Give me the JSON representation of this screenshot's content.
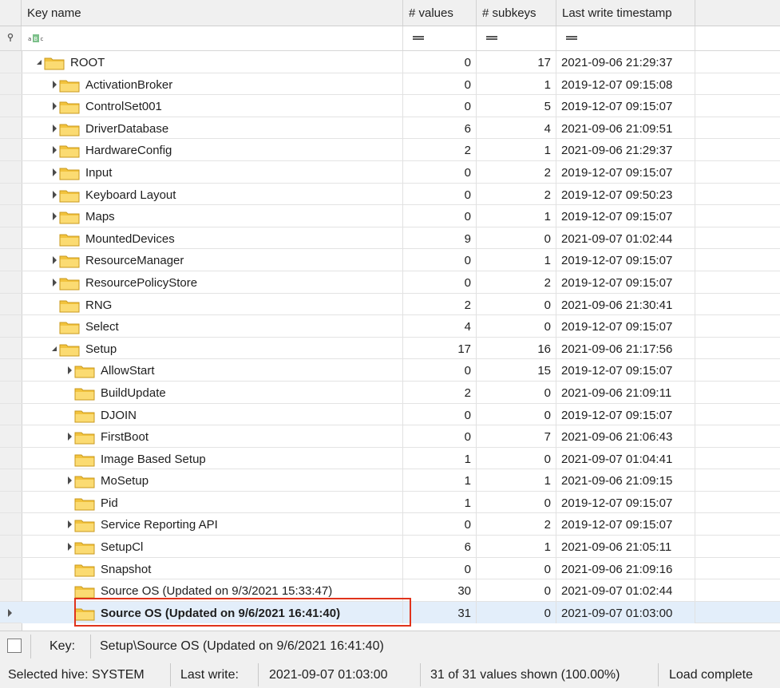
{
  "columns": {
    "key_name": "Key name",
    "values": "# values",
    "subkeys": "# subkeys",
    "timestamp": "Last write timestamp"
  },
  "filter": {
    "key_name_icon": "text-filter-icon",
    "operator_symbol": "="
  },
  "rows": [
    {
      "name": "ROOT",
      "values": "0",
      "subkeys": "17",
      "timestamp": "2021-09-06 21:29:37",
      "level": 0,
      "state": "expanded"
    },
    {
      "name": "ActivationBroker",
      "values": "0",
      "subkeys": "1",
      "timestamp": "2019-12-07 09:15:08",
      "level": 1,
      "state": "collapsed"
    },
    {
      "name": "ControlSet001",
      "values": "0",
      "subkeys": "5",
      "timestamp": "2019-12-07 09:15:07",
      "level": 1,
      "state": "collapsed"
    },
    {
      "name": "DriverDatabase",
      "values": "6",
      "subkeys": "4",
      "timestamp": "2021-09-06 21:09:51",
      "level": 1,
      "state": "collapsed"
    },
    {
      "name": "HardwareConfig",
      "values": "2",
      "subkeys": "1",
      "timestamp": "2021-09-06 21:29:37",
      "level": 1,
      "state": "collapsed"
    },
    {
      "name": "Input",
      "values": "0",
      "subkeys": "2",
      "timestamp": "2019-12-07 09:15:07",
      "level": 1,
      "state": "collapsed"
    },
    {
      "name": "Keyboard Layout",
      "values": "0",
      "subkeys": "2",
      "timestamp": "2019-12-07 09:50:23",
      "level": 1,
      "state": "collapsed"
    },
    {
      "name": "Maps",
      "values": "0",
      "subkeys": "1",
      "timestamp": "2019-12-07 09:15:07",
      "level": 1,
      "state": "collapsed"
    },
    {
      "name": "MountedDevices",
      "values": "9",
      "subkeys": "0",
      "timestamp": "2021-09-07 01:02:44",
      "level": 1,
      "state": "leaf"
    },
    {
      "name": "ResourceManager",
      "values": "0",
      "subkeys": "1",
      "timestamp": "2019-12-07 09:15:07",
      "level": 1,
      "state": "collapsed"
    },
    {
      "name": "ResourcePolicyStore",
      "values": "0",
      "subkeys": "2",
      "timestamp": "2019-12-07 09:15:07",
      "level": 1,
      "state": "collapsed"
    },
    {
      "name": "RNG",
      "values": "2",
      "subkeys": "0",
      "timestamp": "2021-09-06 21:30:41",
      "level": 1,
      "state": "leaf"
    },
    {
      "name": "Select",
      "values": "4",
      "subkeys": "0",
      "timestamp": "2019-12-07 09:15:07",
      "level": 1,
      "state": "leaf"
    },
    {
      "name": "Setup",
      "values": "17",
      "subkeys": "16",
      "timestamp": "2021-09-06 21:17:56",
      "level": 1,
      "state": "expanded"
    },
    {
      "name": "AllowStart",
      "values": "0",
      "subkeys": "15",
      "timestamp": "2019-12-07 09:15:07",
      "level": 2,
      "state": "collapsed"
    },
    {
      "name": "BuildUpdate",
      "values": "2",
      "subkeys": "0",
      "timestamp": "2021-09-06 21:09:11",
      "level": 2,
      "state": "leaf"
    },
    {
      "name": "DJOIN",
      "values": "0",
      "subkeys": "0",
      "timestamp": "2019-12-07 09:15:07",
      "level": 2,
      "state": "leaf"
    },
    {
      "name": "FirstBoot",
      "values": "0",
      "subkeys": "7",
      "timestamp": "2021-09-06 21:06:43",
      "level": 2,
      "state": "collapsed"
    },
    {
      "name": "Image Based Setup",
      "values": "1",
      "subkeys": "0",
      "timestamp": "2021-09-07 01:04:41",
      "level": 2,
      "state": "leaf"
    },
    {
      "name": "MoSetup",
      "values": "1",
      "subkeys": "1",
      "timestamp": "2021-09-06 21:09:15",
      "level": 2,
      "state": "collapsed"
    },
    {
      "name": "Pid",
      "values": "1",
      "subkeys": "0",
      "timestamp": "2019-12-07 09:15:07",
      "level": 2,
      "state": "leaf"
    },
    {
      "name": "Service Reporting API",
      "values": "0",
      "subkeys": "2",
      "timestamp": "2019-12-07 09:15:07",
      "level": 2,
      "state": "collapsed"
    },
    {
      "name": "SetupCl",
      "values": "6",
      "subkeys": "1",
      "timestamp": "2021-09-06 21:05:11",
      "level": 2,
      "state": "collapsed"
    },
    {
      "name": "Snapshot",
      "values": "0",
      "subkeys": "0",
      "timestamp": "2021-09-06 21:09:16",
      "level": 2,
      "state": "leaf"
    },
    {
      "name": "Source OS (Updated on 9/3/2021 15:33:47)",
      "values": "30",
      "subkeys": "0",
      "timestamp": "2021-09-07 01:02:44",
      "level": 2,
      "state": "leaf"
    },
    {
      "name": "Source OS (Updated on 9/6/2021 16:41:40)",
      "values": "31",
      "subkeys": "0",
      "timestamp": "2021-09-07 01:03:00",
      "level": 2,
      "state": "leaf",
      "selected": true
    }
  ],
  "keybar": {
    "label": "Key:",
    "path": "Setup\\Source OS (Updated on 9/6/2021 16:41:40)"
  },
  "status": {
    "hive": "Selected hive: SYSTEM",
    "last_write_label": "Last write:",
    "last_write_value": "2021-09-07 01:03:00",
    "values_shown": "31 of 31 values shown (100.00%)",
    "load_state": "Load complete"
  },
  "colors": {
    "highlight_box": "#e0331c",
    "selected_row": "#e3eefa",
    "folder": "#f6c94a"
  }
}
